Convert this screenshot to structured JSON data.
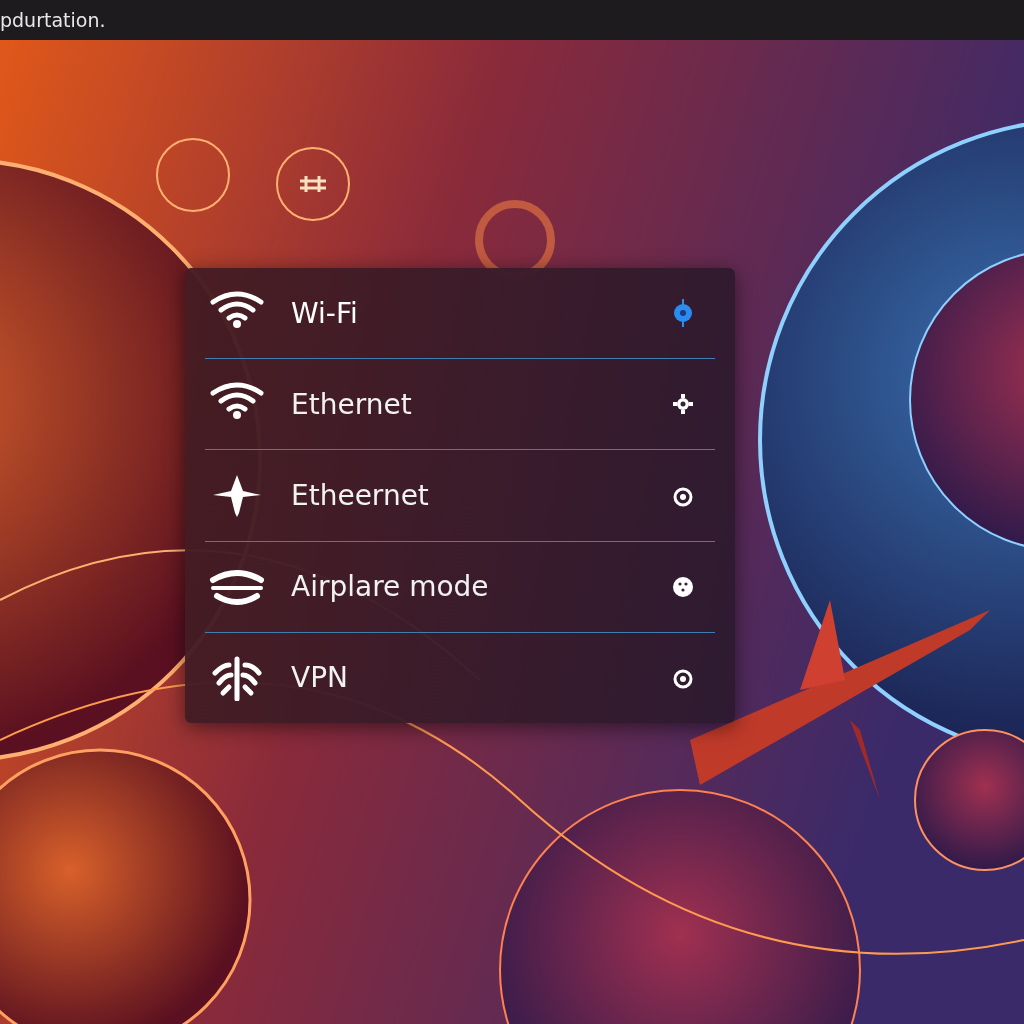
{
  "top_bar": {
    "title": "pdurtation."
  },
  "network_menu": {
    "items": [
      {
        "label": "Wi-Fi",
        "kind": "wifi",
        "indicator": {
          "kind": "toggle"
        },
        "selected": true
      },
      {
        "label": "Ethernet",
        "kind": "wifi",
        "indicator": {
          "kind": "gear"
        },
        "selected": false
      },
      {
        "label": "Etheernet",
        "kind": "airplane",
        "indicator": {
          "kind": "radio"
        },
        "selected": false
      },
      {
        "label": "Airplare mode",
        "kind": "waves",
        "indicator": {
          "kind": "dots"
        },
        "selected": false
      },
      {
        "label": "VPN",
        "kind": "antenna",
        "indicator": {
          "kind": "radio"
        },
        "selected": false
      }
    ]
  }
}
